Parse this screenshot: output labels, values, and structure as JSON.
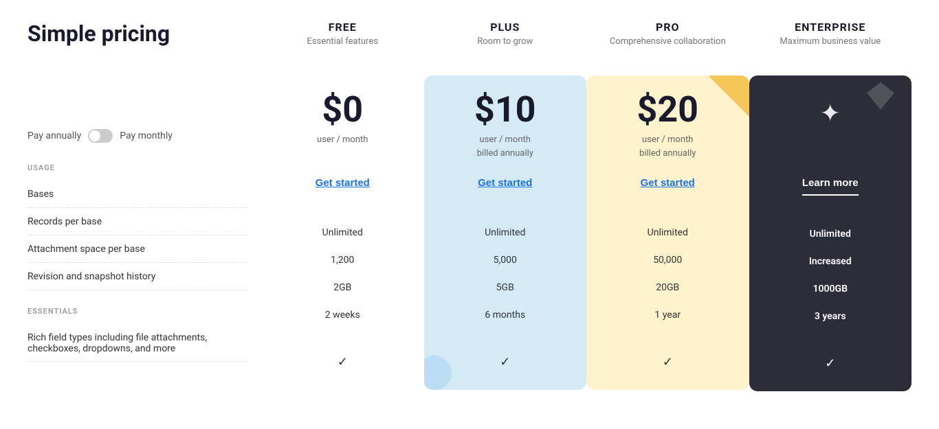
{
  "page": {
    "title": "Simple pricing"
  },
  "billing": {
    "pay_annually_label": "Pay annually",
    "pay_monthly_label": "Pay monthly"
  },
  "sections": {
    "usage_label": "USAGE",
    "essentials_label": "ESSENTIALS"
  },
  "features": {
    "bases": "Bases",
    "records_per_base": "Records per base",
    "attachment_space": "Attachment space per base",
    "revision_history": "Revision and snapshot history",
    "essentials_description": "Rich field types including file attachments, checkboxes, dropdowns, and more"
  },
  "plans": {
    "free": {
      "name": "FREE",
      "tagline": "Essential features",
      "price": "$0",
      "period": "user / month",
      "cta": "Get started",
      "bases": "Unlimited",
      "records": "1,200",
      "attachment": "2GB",
      "revision": "2 weeks"
    },
    "plus": {
      "name": "PLUS",
      "tagline": "Room to grow",
      "price": "$10",
      "period_line1": "user / month",
      "period_line2": "billed annually",
      "cta": "Get started",
      "bases": "Unlimited",
      "records": "5,000",
      "attachment": "5GB",
      "revision": "6 months"
    },
    "pro": {
      "name": "PRO",
      "tagline": "Comprehensive collaboration",
      "price": "$20",
      "period_line1": "user / month",
      "period_line2": "billed annually",
      "cta": "Get started",
      "bases": "Unlimited",
      "records": "50,000",
      "attachment": "20GB",
      "revision": "1 year"
    },
    "enterprise": {
      "name": "ENTERPRISE",
      "tagline": "Maximum business value",
      "sparkle": "✦",
      "cta": "Learn more",
      "bases": "Unlimited",
      "records": "Increased",
      "attachment": "1000GB",
      "revision": "3 years"
    }
  }
}
